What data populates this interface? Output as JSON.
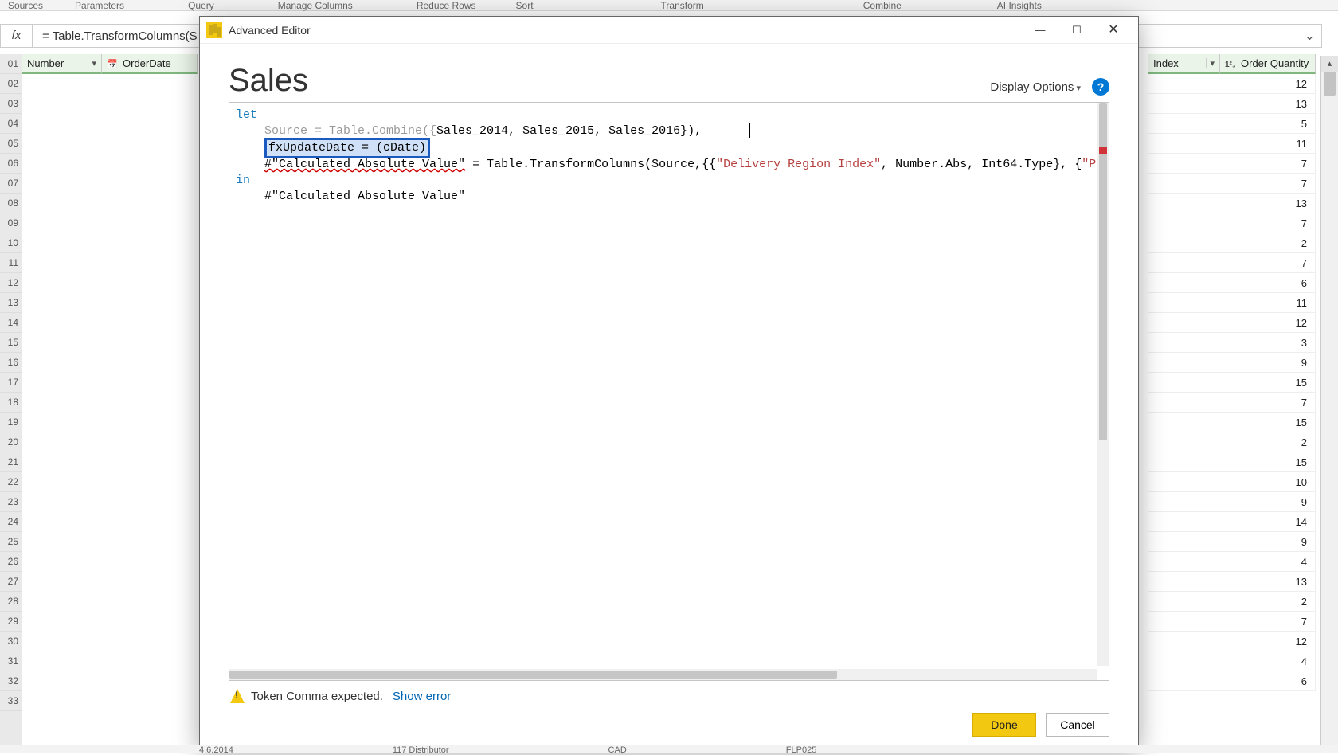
{
  "ribbon_groups": [
    "Sources",
    "Parameters",
    "Query",
    "Manage Columns",
    "Reduce Rows",
    "Sort",
    "Transform",
    "Combine",
    "AI Insights"
  ],
  "formula_bar": {
    "fx": "fx",
    "text": "= Table.TransformColumns(S"
  },
  "left_columns": {
    "col1": "Number",
    "col2": "OrderDate"
  },
  "right_columns": {
    "col1": "Index",
    "col2": "Order Quantity"
  },
  "row_numbers": [
    "01",
    "02",
    "03",
    "04",
    "05",
    "06",
    "07",
    "08",
    "09",
    "10",
    "11",
    "12",
    "13",
    "14",
    "15",
    "16",
    "17",
    "18",
    "19",
    "20",
    "21",
    "22",
    "23",
    "24",
    "25",
    "26",
    "27",
    "28",
    "29",
    "30",
    "31",
    "32",
    "33"
  ],
  "right_values": [
    {
      "qty": "12"
    },
    {
      "qty": "13"
    },
    {
      "qty": "5"
    },
    {
      "qty": "11"
    },
    {
      "qty": "7"
    },
    {
      "qty": "7"
    },
    {
      "qty": "13"
    },
    {
      "qty": "7"
    },
    {
      "qty": "2"
    },
    {
      "qty": "7"
    },
    {
      "qty": "6"
    },
    {
      "qty": "11"
    },
    {
      "qty": "12"
    },
    {
      "qty": "3"
    },
    {
      "qty": "9"
    },
    {
      "qty": "15"
    },
    {
      "qty": "7"
    },
    {
      "qty": "15"
    },
    {
      "qty": "2"
    },
    {
      "qty": "15"
    },
    {
      "qty": "10"
    },
    {
      "qty": "9"
    },
    {
      "qty": "14"
    },
    {
      "qty": "9"
    },
    {
      "qty": "4"
    },
    {
      "qty": "13"
    },
    {
      "qty": "2"
    },
    {
      "qty": "7"
    },
    {
      "qty": "12"
    },
    {
      "qty": "4"
    },
    {
      "qty": "6"
    }
  ],
  "dialog": {
    "title": "Advanced Editor",
    "query_name": "Sales",
    "display_options": "Display Options",
    "code": {
      "kw_let": "let",
      "line_source_pre": "    Source = Table.Combine({",
      "line_source_args": "Sales_2014, Sales_2015, Sales_2016}),",
      "highlighted": "fxUpdateDate = (cDate)",
      "calc_err": "#\"Calculated Absolute Value\"",
      "calc_rest_1": " = Table.TransformColumns(Source,{{",
      "calc_str1": "\"Delivery Region Index\"",
      "calc_rest_2": ", Number.Abs, Int64.Type}, {",
      "calc_str2": "\"Product Description I",
      "kw_in": "in",
      "line_out": "    #\"Calculated Absolute Value\""
    },
    "error": {
      "text": "Token Comma expected.",
      "link": "Show error"
    },
    "buttons": {
      "done": "Done",
      "cancel": "Cancel"
    }
  },
  "status_bar": [
    "4.6.2014",
    "117 Distributor",
    "CAD",
    "FLP025"
  ]
}
